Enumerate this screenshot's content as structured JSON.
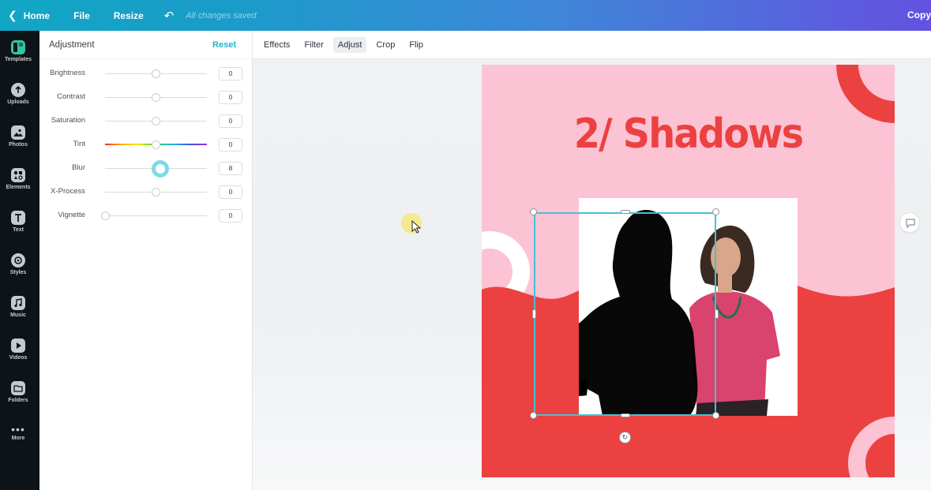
{
  "topbar": {
    "home_label": "Home",
    "file_label": "File",
    "resize_label": "Resize",
    "saved_status": "All changes saved",
    "copy_label": "Copy"
  },
  "rail": {
    "items": [
      {
        "label": "Templates",
        "icon": "templates-icon"
      },
      {
        "label": "Uploads",
        "icon": "upload-icon"
      },
      {
        "label": "Photos",
        "icon": "photos-icon"
      },
      {
        "label": "Elements",
        "icon": "elements-icon"
      },
      {
        "label": "Text",
        "icon": "text-icon"
      },
      {
        "label": "Styles",
        "icon": "styles-icon"
      },
      {
        "label": "Music",
        "icon": "music-icon"
      },
      {
        "label": "Videos",
        "icon": "videos-icon"
      },
      {
        "label": "Folders",
        "icon": "folders-icon"
      },
      {
        "label": "More",
        "icon": "more-icon"
      }
    ]
  },
  "panel": {
    "title": "Adjustment",
    "reset_label": "Reset",
    "sliders": [
      {
        "label": "Brightness",
        "value": "0",
        "level": 0.5
      },
      {
        "label": "Contrast",
        "value": "0",
        "level": 0.5
      },
      {
        "label": "Saturation",
        "value": "0",
        "level": 0.5
      },
      {
        "label": "Tint",
        "value": "0",
        "level": 0.5
      },
      {
        "label": "Blur",
        "value": "8",
        "level": 0.54
      },
      {
        "label": "X-Process",
        "value": "0",
        "level": 0.5
      },
      {
        "label": "Vignette",
        "value": "0",
        "level": 0.0
      }
    ]
  },
  "toolbar": {
    "effects": "Effects",
    "filter": "Filter",
    "adjust": "Adjust",
    "crop": "Crop",
    "flip": "Flip"
  },
  "design": {
    "heading": "2/ Shadows"
  },
  "colors": {
    "accent": "#1fb6c9",
    "design_pink": "#fcc3d4",
    "design_red": "#ec4141"
  }
}
